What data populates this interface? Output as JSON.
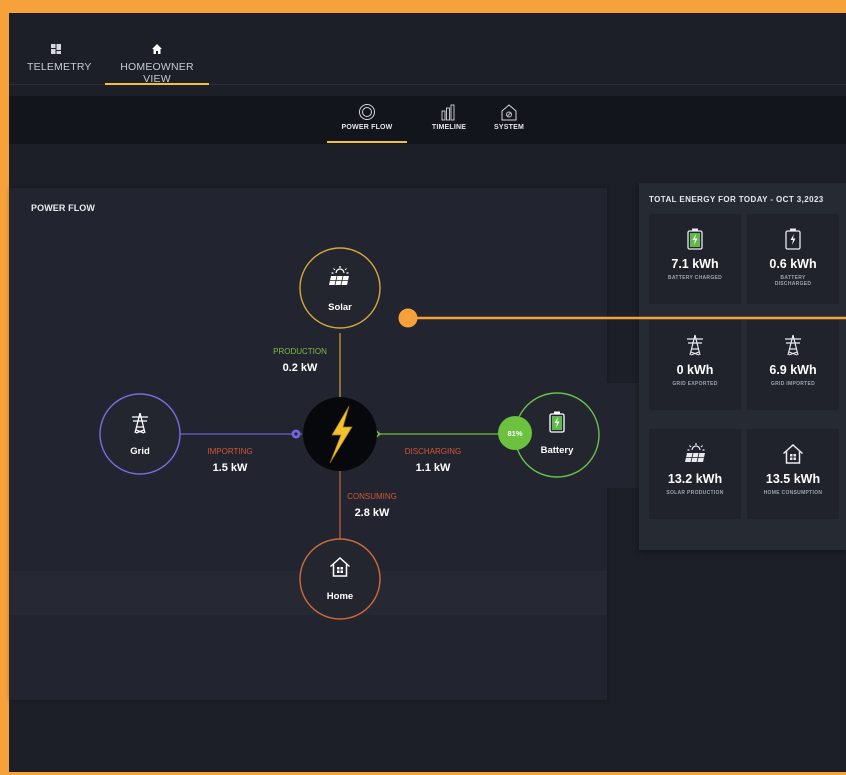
{
  "topnav": {
    "items": [
      {
        "label": "TELEMETRY",
        "icon": "dashboard-icon"
      },
      {
        "label": "HOMEOWNER VIEW",
        "icon": "home-icon",
        "active": true
      }
    ]
  },
  "subnav": {
    "items": [
      {
        "label": "POWER FLOW",
        "icon": "power-flow-icon",
        "active": true
      },
      {
        "label": "TIMELINE",
        "icon": "timeline-icon"
      },
      {
        "label": "SYSTEM",
        "icon": "system-icon"
      }
    ]
  },
  "power_flow": {
    "title": "POWER FLOW",
    "nodes": {
      "solar": {
        "label": "Solar",
        "icon": "solar-panel-icon",
        "color": "#d4a73c"
      },
      "grid": {
        "label": "Grid",
        "icon": "transmission-tower-icon",
        "color": "#7c6be0"
      },
      "battery": {
        "label": "Battery",
        "icon": "battery-icon",
        "color": "#6ac04a",
        "charge": "81%"
      },
      "home": {
        "label": "Home",
        "icon": "house-icon",
        "color": "#cf6a3a"
      },
      "hub": {
        "icon": "lightning-bolt-icon",
        "color": "#f2c230"
      }
    },
    "flows": {
      "production": {
        "label": "PRODUCTION",
        "value": "0.2 kW",
        "color": "#7ebc4a"
      },
      "importing": {
        "label": "IMPORTING",
        "value": "1.5 kW",
        "color": "#d55535"
      },
      "discharging": {
        "label": "DISCHARGING",
        "value": "1.1 kW",
        "color": "#d55535"
      },
      "consuming": {
        "label": "CONSUMING",
        "value": "2.8 kW",
        "color": "#d55535"
      }
    }
  },
  "energy_today": {
    "title": "TOTAL ENERGY FOR TODAY - OCT 3,2023",
    "cards": [
      {
        "value": "7.1 kWh",
        "caption": "BATTERY CHARGED",
        "icon": "battery-charging-icon"
      },
      {
        "value": "0.6 kWh",
        "caption": "BATTERY DISCHARGED",
        "icon": "battery-discharging-icon"
      },
      {
        "value": "0 kWh",
        "caption": "GRID EXPORTED",
        "icon": "transmission-tower-icon"
      },
      {
        "value": "6.9 kWh",
        "caption": "GRID IMPORTED",
        "icon": "transmission-tower-icon"
      },
      {
        "value": "13.2 kWh",
        "caption": "SOLAR PRODUCTION",
        "icon": "solar-panel-icon"
      },
      {
        "value": "13.5 kWh",
        "caption": "HOME CONSUMPTION",
        "icon": "house-icon"
      }
    ]
  },
  "colors": {
    "accent": "#f2c230",
    "annotation": "#f7a13a",
    "background": "#1c1f27"
  }
}
